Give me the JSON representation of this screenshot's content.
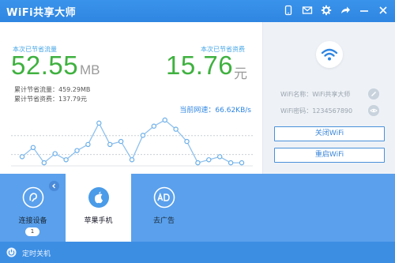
{
  "app": {
    "title": "WiFi共享大师"
  },
  "titlebar": {
    "icons": [
      "phone-icon",
      "mail-icon",
      "gear-icon",
      "share-icon",
      "minimize-icon",
      "close-icon"
    ]
  },
  "stats": {
    "traffic_saved_label": "本次已节省流量",
    "traffic_saved_value": "52.55",
    "traffic_saved_unit": "MB",
    "money_saved_label": "本次已节省资费",
    "money_saved_value": "15.76",
    "money_saved_unit": "元",
    "total_traffic": "累计节省流量：459.29MB",
    "total_money": "累计节省资费：137.79元",
    "current_speed": "当前网速：66.62KB/s"
  },
  "chart_data": {
    "type": "line",
    "values": [
      3,
      6,
      1,
      4,
      2,
      5,
      7,
      14,
      7,
      8,
      2,
      10,
      13,
      15,
      12,
      8,
      1,
      2,
      3,
      1,
      1
    ],
    "grid": true
  },
  "wifi_info": {
    "name": "WiFi名称：WiFi共享大师",
    "password": "WiFi密码：1234567890"
  },
  "buttons": {
    "close_wifi": "关闭WiFi",
    "restart_wifi": "重启WiFi"
  },
  "tiles": [
    {
      "label": "连接设备",
      "badge": "1",
      "icon": "ear-icon"
    },
    {
      "label": "苹果手机",
      "icon": "apple-icon"
    },
    {
      "label": "去广告",
      "icon": "ad-block-icon"
    }
  ],
  "footer": {
    "label": "定时关机",
    "icon": "power-icon"
  },
  "colors": {
    "accent_blue": "#2f86e2",
    "value_green": "#3fb13f",
    "panel_blue": "#5aa0ec",
    "footer_blue": "#3c8ee3"
  }
}
